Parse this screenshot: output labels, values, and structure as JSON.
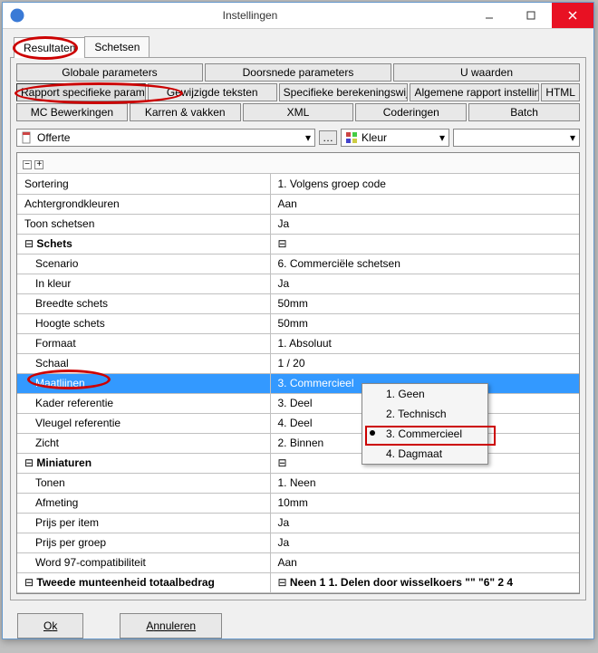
{
  "window": {
    "title": "Instellingen"
  },
  "tabs": [
    "Resultaten",
    "Schetsen"
  ],
  "activeTab": 0,
  "toolbarRows": [
    [
      "Globale parameters",
      "Doorsnede parameters",
      "U waarden"
    ],
    [
      "Rapport specifieke parameters",
      "Gewijzigde teksten",
      "Specifieke berekeningswijzen",
      "Algemene rapport instellingen",
      "HTML"
    ],
    [
      "MC Bewerkingen",
      "Karren & vakken",
      "XML",
      "Coderingen",
      "Batch"
    ]
  ],
  "pressedButton": "Rapport specifieke parameters",
  "combo1": {
    "value": "Offerte",
    "icon": "doc-icon"
  },
  "combo2": {
    "value": "Kleur",
    "icon": "palette-icon"
  },
  "combo3": {
    "value": ""
  },
  "gridHeaderSymbols": [
    "−",
    "+"
  ],
  "rows": [
    {
      "type": "kv",
      "key": "Sortering",
      "val": "1. Volgens groep code"
    },
    {
      "type": "kv",
      "key": "Achtergrondkleuren",
      "val": "Aan"
    },
    {
      "type": "kv",
      "key": "Toon schetsen",
      "val": "Ja"
    },
    {
      "type": "group",
      "key": "Schets"
    },
    {
      "type": "kv",
      "key": "Scenario",
      "val": "6. Commerciële schetsen",
      "indent": true
    },
    {
      "type": "kv",
      "key": "In kleur",
      "val": "Ja",
      "indent": true
    },
    {
      "type": "kv",
      "key": "Breedte schets",
      "val": "50mm",
      "indent": true
    },
    {
      "type": "kv",
      "key": "Hoogte schets",
      "val": "50mm",
      "indent": true
    },
    {
      "type": "kv",
      "key": "Formaat",
      "val": "1. Absoluut",
      "indent": true
    },
    {
      "type": "kv",
      "key": "Schaal",
      "val": "1 / 20",
      "indent": true
    },
    {
      "type": "kv",
      "key": "Maatlijnen",
      "val": "3. Commercieel",
      "indent": true,
      "selected": true
    },
    {
      "type": "kv",
      "key": "Kader referentie",
      "val": "3. Deel",
      "indent": true
    },
    {
      "type": "kv",
      "key": "Vleugel referentie",
      "val": "4. Deel",
      "indent": true
    },
    {
      "type": "kv",
      "key": "Zicht",
      "val": "2. Binnen",
      "indent": true
    },
    {
      "type": "group",
      "key": "Miniaturen"
    },
    {
      "type": "kv",
      "key": "Tonen",
      "val": "1. Neen",
      "indent": true
    },
    {
      "type": "kv",
      "key": "Afmeting",
      "val": "10mm",
      "indent": true
    },
    {
      "type": "kv",
      "key": "Prijs per item",
      "val": "Ja",
      "indent": true
    },
    {
      "type": "kv",
      "key": "Prijs per groep",
      "val": "Ja",
      "indent": true
    },
    {
      "type": "kv",
      "key": "Word 97-compatibiliteit",
      "val": "Aan",
      "indent": true
    },
    {
      "type": "group",
      "key": "Tweede munteenheid totaalbedrag",
      "val": "Neen 1 1. Delen door wisselkoers \"\" \"6\" 2 4",
      "cut": true
    }
  ],
  "contextMenu": {
    "items": [
      "1. Geen",
      "2. Technisch",
      "3. Commercieel",
      "4. Dagmaat"
    ],
    "selectedIndex": 2
  },
  "buttons": {
    "ok": "Ok",
    "cancel": "Annuleren",
    "okUnderline": "O",
    "cancelUnderline": "A"
  }
}
